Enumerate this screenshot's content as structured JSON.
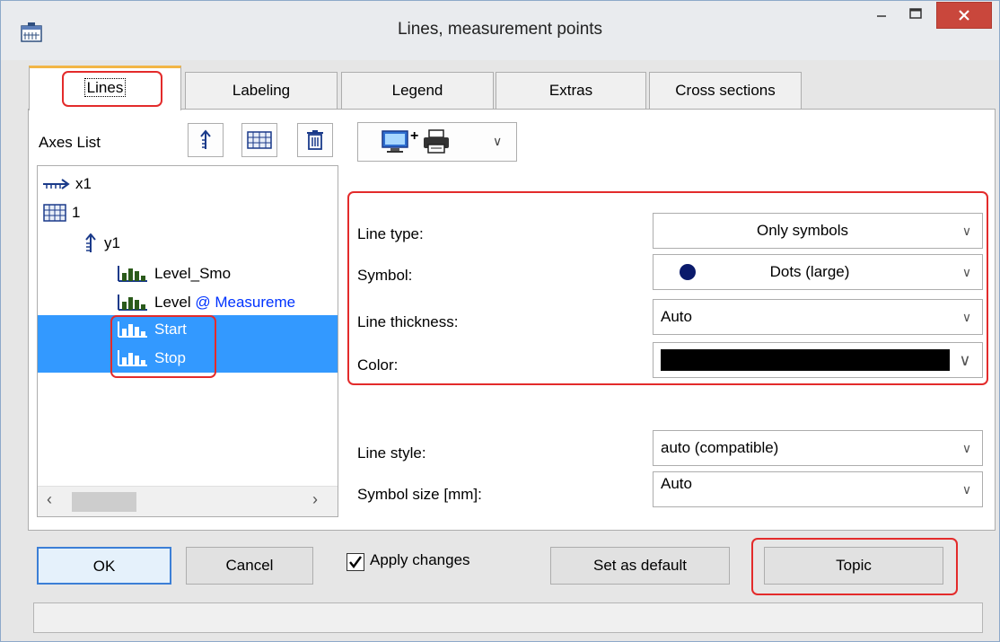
{
  "window": {
    "title": "Lines, measurement points",
    "close_color": "#c9473c"
  },
  "tabs": [
    {
      "label": "Lines",
      "active": true
    },
    {
      "label": "Labeling"
    },
    {
      "label": "Legend"
    },
    {
      "label": "Extras"
    },
    {
      "label": "Cross sections"
    }
  ],
  "axes_list": {
    "label": "Axes List",
    "tools": [
      "axis-add-icon",
      "grid-icon",
      "trash-icon"
    ],
    "items": [
      {
        "icon": "x-axis-icon",
        "text": "x1"
      },
      {
        "icon": "grid-icon",
        "text": "1"
      },
      {
        "icon": "y-axis-icon",
        "text": "y1"
      },
      {
        "icon": "channel-icon",
        "text": "Level_Smo"
      },
      {
        "icon": "channel-icon",
        "text": "Level",
        "suffix": "@ Measureme"
      },
      {
        "icon": "channel-icon",
        "text": "Start",
        "selected": true
      },
      {
        "icon": "channel-icon",
        "text": "Stop",
        "selected": true
      }
    ]
  },
  "device_selector": {
    "icons": [
      "monitor-icon",
      "printer-icon"
    ],
    "plus": "+"
  },
  "form": {
    "line_type": {
      "label": "Line type:",
      "value": "Only symbols"
    },
    "symbol": {
      "label": "Symbol:",
      "value": "Dots (large)",
      "symbol_color": "#0a1a6b"
    },
    "line_thickness": {
      "label": "Line thickness:",
      "value": "Auto"
    },
    "color": {
      "label": "Color:",
      "value_color": "#000000"
    },
    "line_style": {
      "label": "Line style:",
      "value": "auto (compatible)"
    },
    "symbol_size": {
      "label": "Symbol size [mm]:",
      "value": "Auto"
    }
  },
  "buttons": {
    "ok": "OK",
    "cancel": "Cancel",
    "apply_changes": "Apply changes",
    "apply_checked": true,
    "set_default": "Set as default",
    "topic": "Topic"
  },
  "highlight_color": "#e32b2b",
  "selection_color": "#3399ff"
}
